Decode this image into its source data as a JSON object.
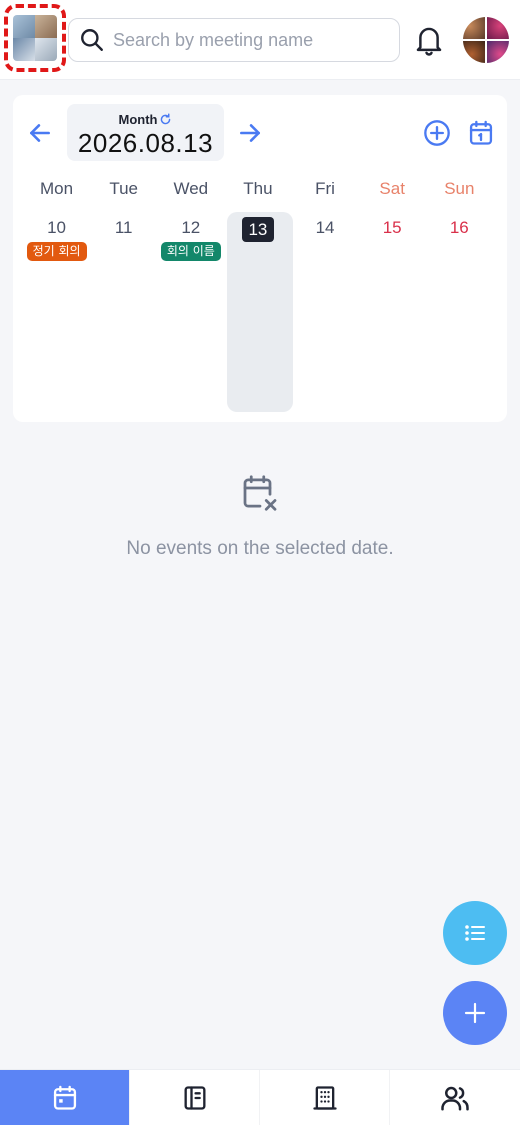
{
  "header": {
    "logo_icon": "album-thumbnail-icon",
    "search": {
      "placeholder": "Search by meeting name",
      "value": ""
    },
    "notification_icon": "bell-icon",
    "avatar_icon": "user-avatar"
  },
  "calendar": {
    "view_mode": "Month",
    "selected_date": "2026.08.13",
    "prev_icon": "arrow-left-icon",
    "next_icon": "arrow-right-icon",
    "refresh_icon": "refresh-icon",
    "add_icon": "plus-circle-icon",
    "today_icon": "calendar-today-icon",
    "weekdays": [
      "Mon",
      "Tue",
      "Wed",
      "Thu",
      "Fri",
      "Sat",
      "Sun"
    ],
    "days": [
      {
        "num": "10",
        "event": "정기 회의",
        "event_color": "#e2590f"
      },
      {
        "num": "11",
        "event": "",
        "event_color": ""
      },
      {
        "num": "12",
        "event": "회의 이름",
        "event_color": "#13876a"
      },
      {
        "num": "13",
        "event": "",
        "event_color": "",
        "today": true
      },
      {
        "num": "14",
        "event": "",
        "event_color": ""
      },
      {
        "num": "15",
        "event": "",
        "event_color": ""
      },
      {
        "num": "16",
        "event": "",
        "event_color": ""
      }
    ]
  },
  "empty_state": {
    "icon": "calendar-x-icon",
    "message": "No events on the selected date."
  },
  "fab": {
    "list_icon": "list-icon",
    "add_icon": "plus-icon"
  },
  "bottom_nav": {
    "items": [
      {
        "icon": "calendar-icon",
        "active": true
      },
      {
        "icon": "notebook-icon",
        "active": false
      },
      {
        "icon": "building-icon",
        "active": false
      },
      {
        "icon": "users-icon",
        "active": false
      }
    ]
  },
  "colors": {
    "accent": "#5b84f5",
    "fab_list": "#4dbdf2",
    "weekend_header": "#e8826a",
    "weekend_day": "#d9304a"
  }
}
